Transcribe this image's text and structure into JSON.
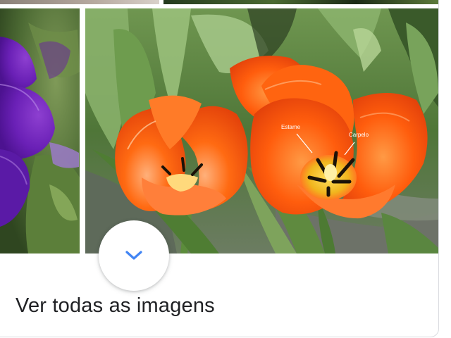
{
  "panel": {
    "see_all_label": "Ver todas as imagens"
  },
  "images": [
    {
      "subject": "purple pansy flower"
    },
    {
      "subject": "orange tulips",
      "annotations": [
        "Estame",
        "Carpelo"
      ]
    }
  ],
  "icons": {
    "expand": "chevron-down-icon"
  },
  "colors": {
    "chevron": "#4285f4",
    "text": "#202124",
    "border": "#dadce0"
  }
}
